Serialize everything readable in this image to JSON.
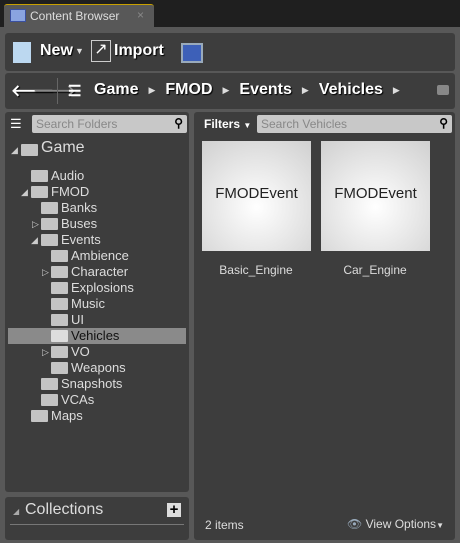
{
  "tab": {
    "title": "Content Browser",
    "close": "×"
  },
  "toolbar": {
    "new_label": "New",
    "import_label": "Import"
  },
  "breadcrumb": [
    "Game",
    "FMOD",
    "Events",
    "Vehicles"
  ],
  "folders": {
    "search_placeholder": "Search Folders",
    "tree": [
      {
        "label": "Game",
        "level": 0,
        "expanded": true
      },
      {
        "label": "Audio",
        "level": 1
      },
      {
        "label": "FMOD",
        "level": 1,
        "expanded": true
      },
      {
        "label": "Banks",
        "level": 2
      },
      {
        "label": "Buses",
        "level": 2,
        "collapsed": true
      },
      {
        "label": "Events",
        "level": 2,
        "expanded": true
      },
      {
        "label": "Ambience",
        "level": 3
      },
      {
        "label": "Character",
        "level": 3,
        "collapsed": true
      },
      {
        "label": "Explosions",
        "level": 3
      },
      {
        "label": "Music",
        "level": 3
      },
      {
        "label": "UI",
        "level": 3
      },
      {
        "label": "Vehicles",
        "level": 3,
        "selected": true
      },
      {
        "label": "VO",
        "level": 3,
        "collapsed": true
      },
      {
        "label": "Weapons",
        "level": 3
      },
      {
        "label": "Snapshots",
        "level": 2
      },
      {
        "label": "VCAs",
        "level": 2
      },
      {
        "label": "Maps",
        "level": 1
      }
    ]
  },
  "collections": {
    "title": "Collections",
    "add": "+"
  },
  "assets": {
    "filters_label": "Filters",
    "search_placeholder": "Search Vehicles",
    "items": [
      {
        "thumb": "FMODEvent",
        "name": "Basic_Engine"
      },
      {
        "thumb": "FMODEvent",
        "name": "Car_Engine"
      }
    ],
    "count": "2 items",
    "view_options": "View Options"
  }
}
